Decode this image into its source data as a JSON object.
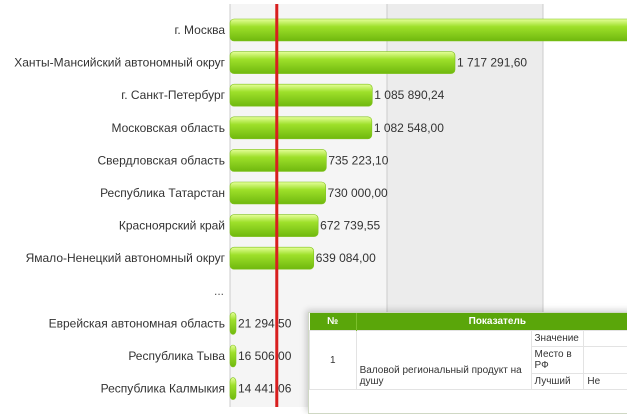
{
  "chart_data": {
    "type": "bar",
    "orientation": "horizontal",
    "categories": [
      "г. Москва",
      "Ханты-Мансийский автономный округ",
      "г. Санкт-Петербург",
      "Московская область",
      "Свердловская область",
      "Республика Татарстан",
      "Красноярский край",
      "Ямало-Ненецкий автономный округ",
      "...",
      "Еврейская автономная область",
      "Республика Тыва",
      "Республика Калмыкия"
    ],
    "values": [
      null,
      1717291.6,
      1085890.24,
      1082548.0,
      735223.1,
      730000.0,
      672739.55,
      639084.0,
      null,
      21294.5,
      16506.0,
      14441.06
    ],
    "value_labels": [
      "",
      "1 717 291,60",
      "1 085 890,24",
      "1 082 548,00",
      "735 223,10",
      "730 000,00",
      "672 739,55",
      "639 084,00",
      "",
      "21 294,50",
      "16 506,00",
      "14 441,06"
    ],
    "reference_line": 151000,
    "colors": {
      "bar": "#9ee02a",
      "bar_dark": "#6fb80e",
      "reference_line": "#d81e1e",
      "grid": "#cccccc"
    }
  },
  "table": {
    "headers": {
      "num": "№",
      "indicator": "Показатель"
    },
    "row": {
      "num": "1",
      "indicator": "Валовой региональный продукт на душу",
      "sub_value": "Значение",
      "sub_place": "Место в РФ",
      "sub_best": "Лучший",
      "best_fragment": "Не"
    }
  }
}
